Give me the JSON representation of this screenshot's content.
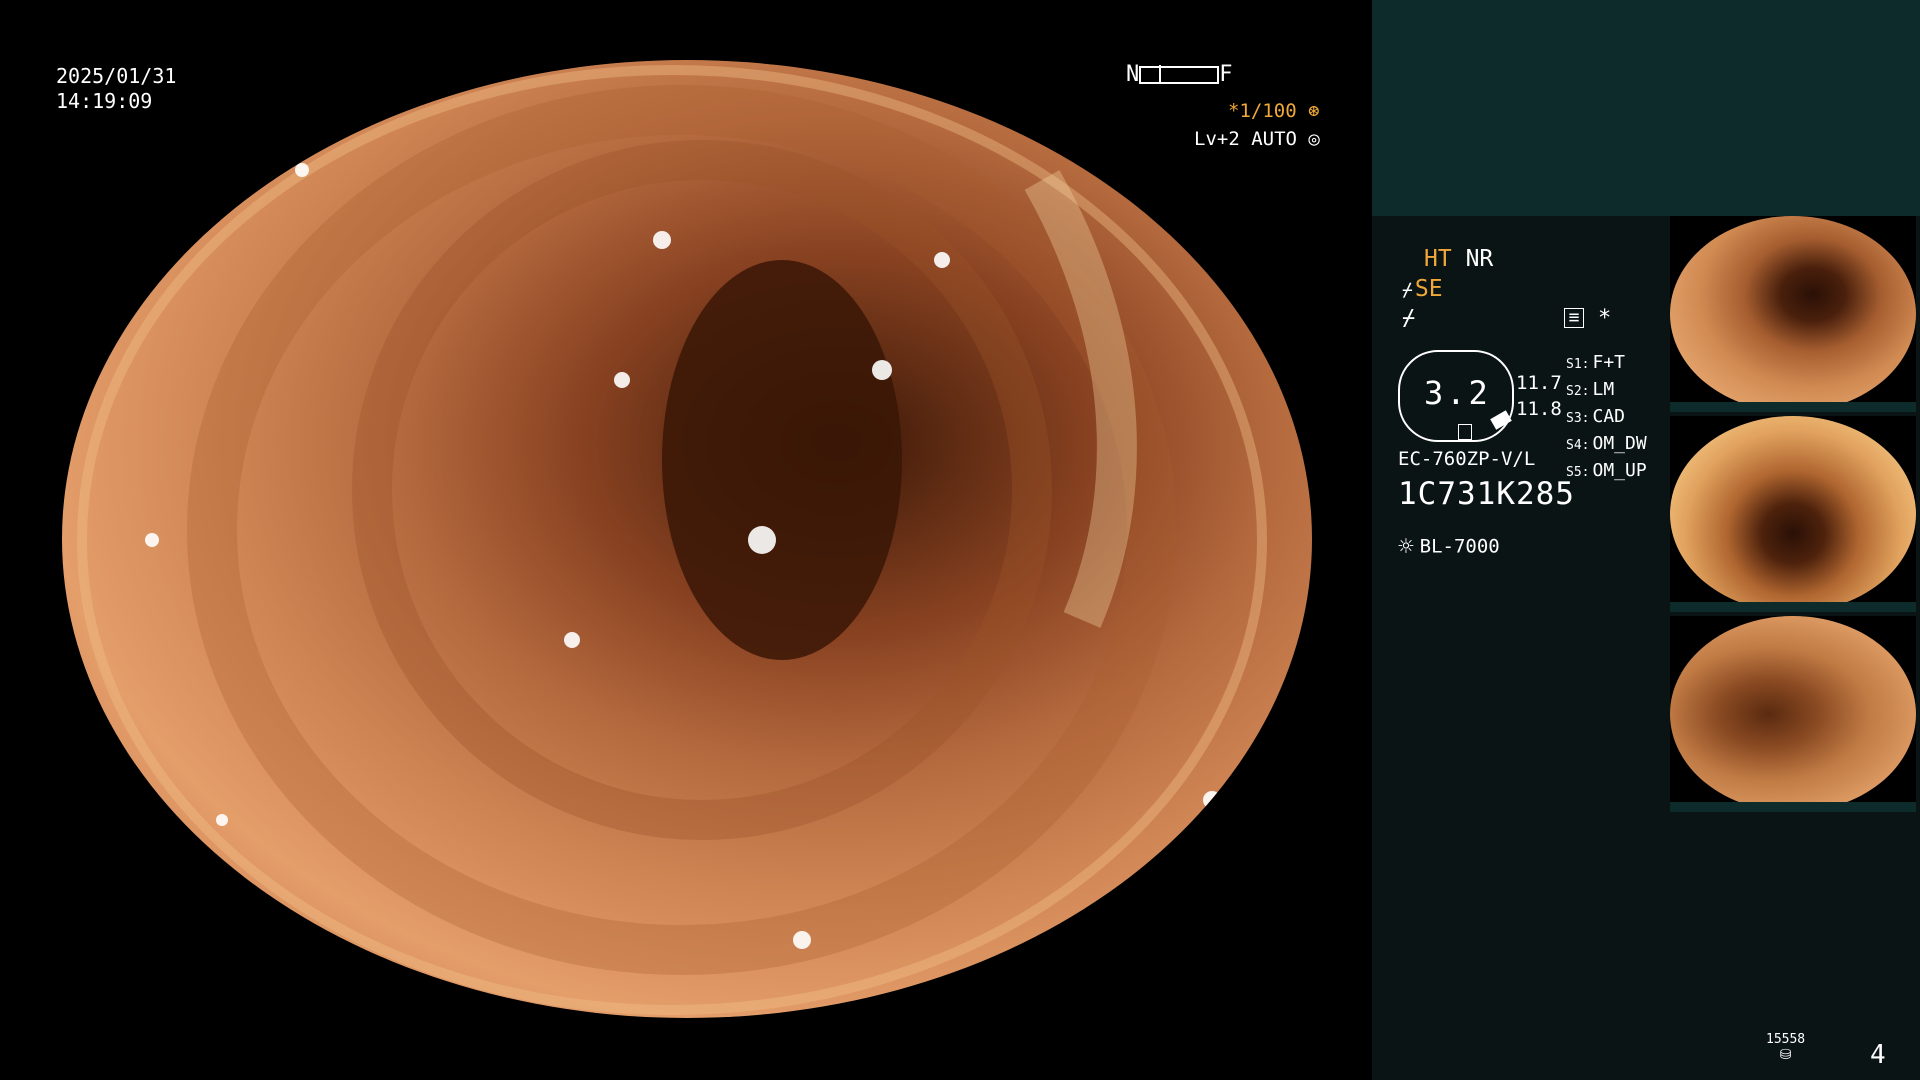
{
  "datetime": {
    "date": "2025/01/31",
    "time": "14:19:09"
  },
  "scale": {
    "near": "N",
    "far": "F"
  },
  "zoom": "*1/100",
  "level": "Lv+2 AUTO",
  "settings": {
    "ht": "HT",
    "nr": "NR",
    "se": "SE",
    "s_list": [
      {
        "key": "S1:",
        "value": "F+T"
      },
      {
        "key": "S2:",
        "value": "LM"
      },
      {
        "key": "S3:",
        "value": "CAD"
      },
      {
        "key": "S4:",
        "value": "OM_DW"
      },
      {
        "key": "S5:",
        "value": "OM_UP"
      }
    ]
  },
  "gauge": {
    "value": "3.2",
    "reading_1": "11.7",
    "reading_2": "11.8"
  },
  "scope_model": "EC-760ZP-V/L",
  "scope_serial": "1C731K285",
  "light_source": "BL-7000",
  "image_count": "15558",
  "page_number": "4",
  "colors": {
    "accent": "#f0a838",
    "panel": "#0b1414",
    "panel_top": "#0d2b2b"
  }
}
